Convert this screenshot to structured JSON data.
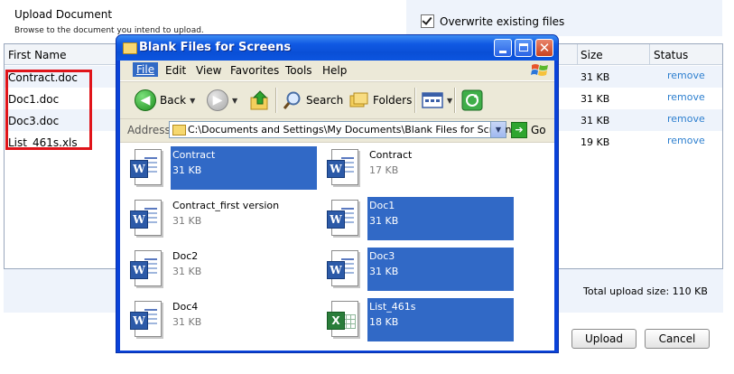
{
  "upload": {
    "title": "Upload Document",
    "subtitle": "Browse to the document you intend to upload.",
    "overwrite_label": "Overwrite existing files",
    "columns": [
      "First Name",
      "Size",
      "Status"
    ],
    "rows": [
      {
        "name": "Contract.doc",
        "size": "31 KB",
        "status": "remove"
      },
      {
        "name": "Doc1.doc",
        "size": "31 KB",
        "status": "remove"
      },
      {
        "name": "Doc3.doc",
        "size": "31 KB",
        "status": "remove"
      },
      {
        "name": "List_461s.xls",
        "size": "19 KB",
        "status": "remove"
      }
    ],
    "total": "Total upload size: 110 KB",
    "upload_button": "Upload",
    "cancel_button": "Cancel"
  },
  "explorer": {
    "title": "Blank Files for Screens",
    "menu": [
      "File",
      "Edit",
      "View",
      "Favorites",
      "Tools",
      "Help"
    ],
    "toolbar": {
      "back": "Back",
      "search": "Search",
      "folders": "Folders"
    },
    "address_label": "Address",
    "address": "C:\\Documents and Settings\\My Documents\\Blank Files for Screens",
    "go": "Go",
    "files": [
      {
        "name": "Contract",
        "size": "31 KB",
        "type": "word",
        "selected": true
      },
      {
        "name": "Contract",
        "size": "17 KB",
        "type": "word",
        "selected": false
      },
      {
        "name": "Contract_first version",
        "size": "31 KB",
        "type": "word",
        "selected": false
      },
      {
        "name": "Doc1",
        "size": "31 KB",
        "type": "word",
        "selected": true
      },
      {
        "name": "Doc2",
        "size": "31 KB",
        "type": "word",
        "selected": false
      },
      {
        "name": "Doc3",
        "size": "31 KB",
        "type": "word",
        "selected": true
      },
      {
        "name": "Doc4",
        "size": "31 KB",
        "type": "word",
        "selected": false
      },
      {
        "name": "List_461s",
        "size": "18 KB",
        "type": "excel",
        "selected": true
      }
    ]
  },
  "colors": {
    "selection": "#3169c6",
    "xp_blue": "#0a42d8",
    "link": "#2d7fcf",
    "highlight_box": "#e0141a"
  }
}
